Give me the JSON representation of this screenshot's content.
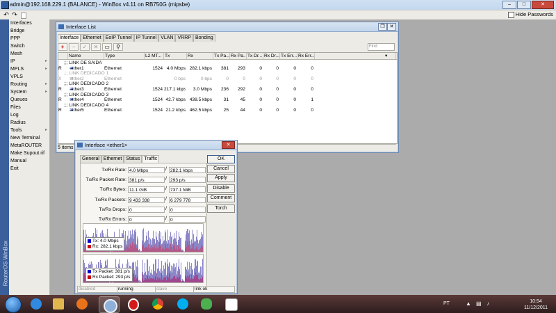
{
  "window": {
    "title": "admin@192.168.229.1 (BALANCE) - WinBox v4.11 on RB750G (mipsbe)"
  },
  "toolbar": {
    "hide_passwords_label": "Hide Passwords"
  },
  "sidebar": {
    "brand": "RouterOS WinBox",
    "items": [
      {
        "label": "Interfaces",
        "arrow": false
      },
      {
        "label": "Bridge",
        "arrow": false
      },
      {
        "label": "PPP",
        "arrow": false
      },
      {
        "label": "Switch",
        "arrow": false
      },
      {
        "label": "Mesh",
        "arrow": false
      },
      {
        "label": "IP",
        "arrow": true
      },
      {
        "label": "MPLS",
        "arrow": true
      },
      {
        "label": "VPLS",
        "arrow": false
      },
      {
        "label": "Routing",
        "arrow": true
      },
      {
        "label": "System",
        "arrow": true
      },
      {
        "label": "Queues",
        "arrow": false
      },
      {
        "label": "Files",
        "arrow": false
      },
      {
        "label": "Log",
        "arrow": false
      },
      {
        "label": "Radius",
        "arrow": false
      },
      {
        "label": "Tools",
        "arrow": true
      },
      {
        "label": "New Terminal",
        "arrow": false
      },
      {
        "label": "MetaROUTER",
        "arrow": false
      },
      {
        "label": "Make Supout.rif",
        "arrow": false
      },
      {
        "label": "Manual",
        "arrow": false
      },
      {
        "label": "Exit",
        "arrow": false
      }
    ]
  },
  "interface_list": {
    "title": "Interface List",
    "tabs": [
      "Interface",
      "Ethernet",
      "EoIP Tunnel",
      "IP Tunnel",
      "VLAN",
      "VRRP",
      "Bonding"
    ],
    "find_placeholder": "Find",
    "columns": [
      "Name",
      "Type",
      "L2 MT...",
      "Tx",
      "Rx",
      "Tx Pa...",
      "Rx Pa...",
      "Tx Dr...",
      "Rx Dr...",
      "Tx Err...",
      "Rx Err..."
    ],
    "rows": [
      {
        "kind": "comment",
        "text": ";;; LINK DE SAIDA"
      },
      {
        "kind": "data",
        "flag": "R",
        "name": "ether1",
        "type": "Ethernet",
        "l2mtu": "1524",
        "tx": "4.0 Mbps",
        "rx": "282.1 kbps",
        "txp": "381",
        "rxp": "293",
        "txd": "0",
        "rxd": "0",
        "txe": "0",
        "rxe": "0"
      },
      {
        "kind": "comment-disabled",
        "text": ";;; LINK DEDICADO 1"
      },
      {
        "kind": "disabled",
        "flag": "X",
        "name": "ether2",
        "type": "Ethernet",
        "l2mtu": "",
        "tx": "0 bps",
        "rx": "0 bps",
        "txp": "0",
        "rxp": "0",
        "txd": "0",
        "rxd": "0",
        "txe": "0",
        "rxe": "0"
      },
      {
        "kind": "comment",
        "text": ";;; LINK DEDICADO 2"
      },
      {
        "kind": "data",
        "flag": "R",
        "name": "ether3",
        "type": "Ethernet",
        "l2mtu": "1524",
        "tx": "217.1 kbps",
        "rx": "3.0 Mbps",
        "txp": "236",
        "rxp": "292",
        "txd": "0",
        "rxd": "0",
        "txe": "0",
        "rxe": "0"
      },
      {
        "kind": "comment",
        "text": ";;; LINK DEDICADO 3"
      },
      {
        "kind": "data",
        "flag": "R",
        "name": "ether4",
        "type": "Ethernet",
        "l2mtu": "1524",
        "tx": "42.7 kbps",
        "rx": "438.5 kbps",
        "txp": "31",
        "rxp": "45",
        "txd": "0",
        "rxd": "0",
        "txe": "0",
        "rxe": "1"
      },
      {
        "kind": "comment",
        "text": ";;; LINK DEDICADO 4"
      },
      {
        "kind": "data",
        "flag": "R",
        "name": "ether5",
        "type": "Ethernet",
        "l2mtu": "1524",
        "tx": "21.2 kbps",
        "rx": "462.5 kbps",
        "txp": "25",
        "rxp": "44",
        "txd": "0",
        "rxd": "0",
        "txe": "0",
        "rxe": "0"
      }
    ],
    "status": "5 items"
  },
  "iface_dialog": {
    "title": "Interface <ether1>",
    "tabs": [
      "General",
      "Ethernet",
      "Status",
      "Traffic"
    ],
    "fields": [
      {
        "label": "Tx/Rx Rate:",
        "v1": "4.0 Mbps",
        "v2": "282.1 kbps"
      },
      {
        "label": "Tx/Rx Packet Rate:",
        "v1": "381 p/s",
        "v2": "293 p/s"
      },
      {
        "label": "Tx/Rx Bytes:",
        "v1": "11.1 GiB",
        "v2": "737.1 MiB"
      },
      {
        "label": "Tx/Rx Packets:",
        "v1": "9 433 338",
        "v2": "6 279 778"
      },
      {
        "label": "Tx/Rx Drops:",
        "v1": "0",
        "v2": "0"
      },
      {
        "label": "Tx/Rx Errors:",
        "v1": "0",
        "v2": "0"
      }
    ],
    "legend_rate": {
      "tx": "Tx:  4.0 Mbps",
      "rx": "Rx:  282.1 kbps"
    },
    "legend_packets": {
      "tx": "Tx Packet:  381 p/s",
      "rx": "Rx Packet:  293 p/s"
    },
    "buttons": [
      "OK",
      "Cancel",
      "Apply",
      "Disable",
      "Comment",
      "Torch"
    ],
    "status": [
      "disabled",
      "running",
      "slave",
      "link ok"
    ],
    "colors": {
      "tx": "#0000cc",
      "rx": "#cc0000"
    }
  },
  "taskbar": {
    "language": "PT",
    "time": "10:54",
    "date": "11/12/2011"
  }
}
